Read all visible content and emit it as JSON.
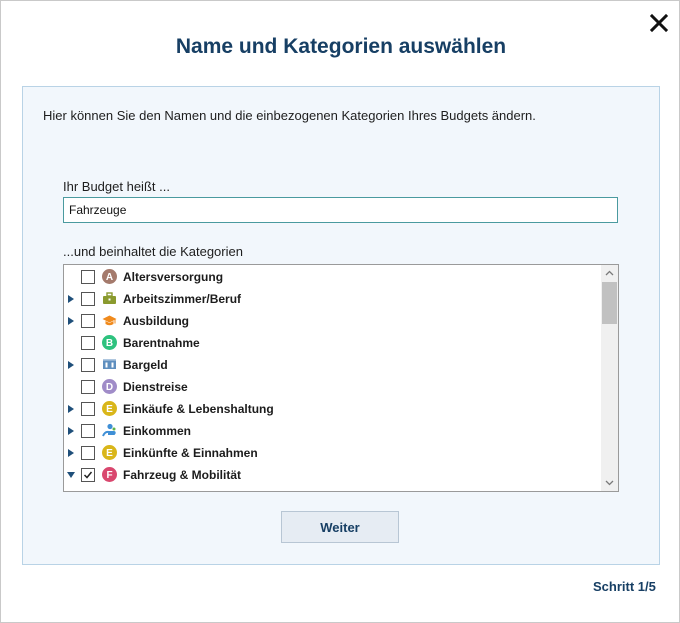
{
  "dialog": {
    "title": "Name und Kategorien auswählen",
    "intro": "Hier können Sie den Namen und die einbezogenen Kategorien Ihres Budgets ändern.",
    "name_label": "Ihr Budget heißt ...",
    "name_value": "Fahrzeuge",
    "categories_label": "...und beinhaltet die Kategorien",
    "next_button": "Weiter",
    "step": "Schritt 1/5"
  },
  "categories": [
    {
      "label": "Altersversorgung",
      "expandable": false,
      "expanded": false,
      "checked": false,
      "icon": "letter-a-icon",
      "icon_letter": "A",
      "icon_color": "#a47a6c"
    },
    {
      "label": "Arbeitszimmer/Beruf",
      "expandable": true,
      "expanded": false,
      "checked": false,
      "icon": "briefcase-icon",
      "icon_color": "#8a9a2e"
    },
    {
      "label": "Ausbildung",
      "expandable": true,
      "expanded": false,
      "checked": false,
      "icon": "graduation-cap-icon",
      "icon_color": "#f08a1c"
    },
    {
      "label": "Barentnahme",
      "expandable": false,
      "expanded": false,
      "checked": false,
      "icon": "letter-b-icon",
      "icon_letter": "B",
      "icon_color": "#2ec27e"
    },
    {
      "label": "Bargeld",
      "expandable": true,
      "expanded": false,
      "checked": false,
      "icon": "cash-icon",
      "icon_color": "#5f8fbf"
    },
    {
      "label": "Dienstreise",
      "expandable": false,
      "expanded": false,
      "checked": false,
      "icon": "letter-d-icon",
      "icon_letter": "D",
      "icon_color": "#a08cc8"
    },
    {
      "label": "Einkäufe & Lebenshaltung",
      "expandable": true,
      "expanded": false,
      "checked": false,
      "icon": "letter-e-icon",
      "icon_letter": "E",
      "icon_color": "#d9b61a"
    },
    {
      "label": "Einkommen",
      "expandable": true,
      "expanded": false,
      "checked": false,
      "icon": "person-hand-icon",
      "icon_color": "#3f8fd6"
    },
    {
      "label": "Einkünfte & Einnahmen",
      "expandable": true,
      "expanded": false,
      "checked": false,
      "icon": "letter-e-icon",
      "icon_letter": "E",
      "icon_color": "#d9b61a"
    },
    {
      "label": "Fahrzeug & Mobilität",
      "expandable": true,
      "expanded": true,
      "checked": true,
      "icon": "letter-f-icon",
      "icon_letter": "F",
      "icon_color": "#d9476e"
    }
  ],
  "colors": {
    "title": "#173f64",
    "panel_bg": "#f2f7fc",
    "panel_border": "#b9d3e6",
    "input_border": "#4a9a9f",
    "tree_arrow": "#1f4f7a"
  }
}
